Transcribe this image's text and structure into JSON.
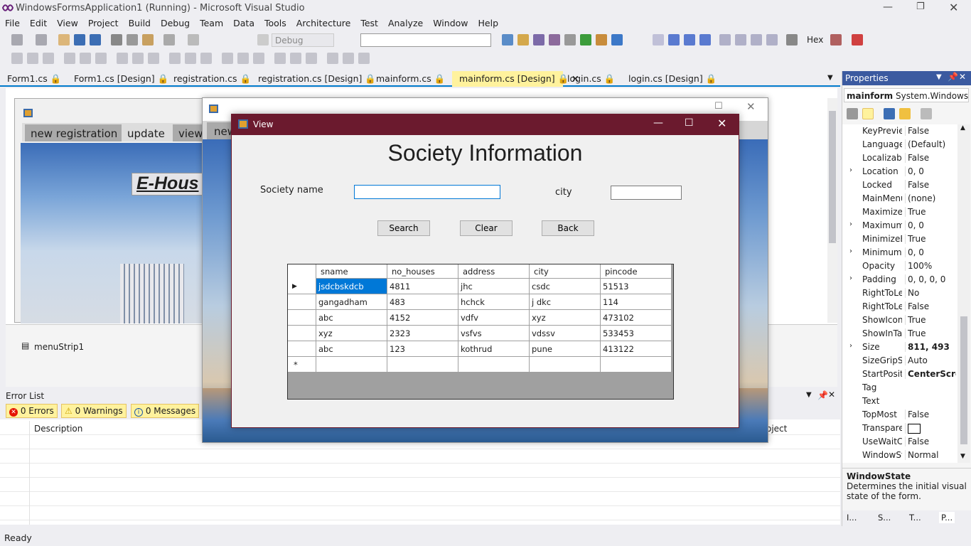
{
  "window_title": "WindowsFormsApplication1 (Running) - Microsoft Visual Studio",
  "menu": [
    "File",
    "Edit",
    "View",
    "Project",
    "Build",
    "Debug",
    "Team",
    "Data",
    "Tools",
    "Architecture",
    "Test",
    "Analyze",
    "Window",
    "Help"
  ],
  "toolbar": {
    "config": "Debug",
    "hex": "Hex"
  },
  "tabs": [
    {
      "label": "Form1.cs"
    },
    {
      "label": "Form1.cs [Design]"
    },
    {
      "label": "registration.cs"
    },
    {
      "label": "registration.cs [Design]"
    },
    {
      "label": "mainform.cs"
    },
    {
      "label": "mainform.cs [Design]"
    },
    {
      "label": "login.cs"
    },
    {
      "label": "login.cs [Design]"
    }
  ],
  "designer": {
    "menu_items": [
      "new registration",
      "update",
      "view"
    ],
    "back_menu_item": "new",
    "banner": "E-Hous",
    "component": "menuStrip1"
  },
  "dialog": {
    "title": "View",
    "heading": "Society Information",
    "society_label": "Society name",
    "city_label": "city",
    "society_value": "",
    "city_value": "",
    "search": "Search",
    "clear": "Clear",
    "back": "Back",
    "columns": [
      "sname",
      "no_houses",
      "address",
      "city",
      "pincode"
    ],
    "rows": [
      [
        "jsdcbskdcb",
        "4811",
        "jhc",
        "csdc",
        "51513"
      ],
      [
        "gangadham",
        "483",
        "hchck",
        "j dkc",
        "114"
      ],
      [
        "abc",
        "4152",
        "vdfv",
        "xyz",
        "473102"
      ],
      [
        "xyz",
        "2323",
        "vsfvs",
        "vdssv",
        "533453"
      ],
      [
        "abc",
        "123",
        "kothrud",
        "pune",
        "413122"
      ]
    ],
    "new_row_marker": "*"
  },
  "properties": {
    "title": "Properties",
    "object": "mainform",
    "object_type": "System.Windows.",
    "rows": [
      {
        "n": "KeyPreview",
        "v": "False"
      },
      {
        "n": "Language",
        "v": "(Default)"
      },
      {
        "n": "Localizable",
        "v": "False"
      },
      {
        "n": "Location",
        "v": "0, 0"
      },
      {
        "n": "Locked",
        "v": "False"
      },
      {
        "n": "MainMenu",
        "v": "(none)"
      },
      {
        "n": "MaximizeBox",
        "v": "True"
      },
      {
        "n": "MaximumSize",
        "v": "0, 0"
      },
      {
        "n": "MinimizeBox",
        "v": "True"
      },
      {
        "n": "MinimumSize",
        "v": "0, 0"
      },
      {
        "n": "Opacity",
        "v": "100%"
      },
      {
        "n": "Padding",
        "v": "0, 0, 0, 0"
      },
      {
        "n": "RightToLeft",
        "v": "No"
      },
      {
        "n": "RightToLeftLayout",
        "v": "False"
      },
      {
        "n": "ShowIcon",
        "v": "True"
      },
      {
        "n": "ShowInTaskbar",
        "v": "True"
      },
      {
        "n": "Size",
        "v": "811, 493"
      },
      {
        "n": "SizeGripStyle",
        "v": "Auto"
      },
      {
        "n": "StartPosition",
        "v": "CenterScreen"
      },
      {
        "n": "Tag",
        "v": ""
      },
      {
        "n": "Text",
        "v": ""
      },
      {
        "n": "TopMost",
        "v": "False"
      },
      {
        "n": "TransparencyKey",
        "v": ""
      },
      {
        "n": "UseWaitCursor",
        "v": "False"
      },
      {
        "n": "WindowState",
        "v": "Normal"
      }
    ],
    "desc_title": "WindowState",
    "desc_text": "Determines the initial visual state of the form.",
    "bottom_tabs": [
      "I...",
      "S...",
      "T...",
      "P..."
    ]
  },
  "error_list": {
    "title": "Error List",
    "errors": "0 Errors",
    "warnings": "0 Warnings",
    "messages": "0 Messages",
    "col_description": "Description",
    "col_project": "oject"
  },
  "status": "Ready"
}
